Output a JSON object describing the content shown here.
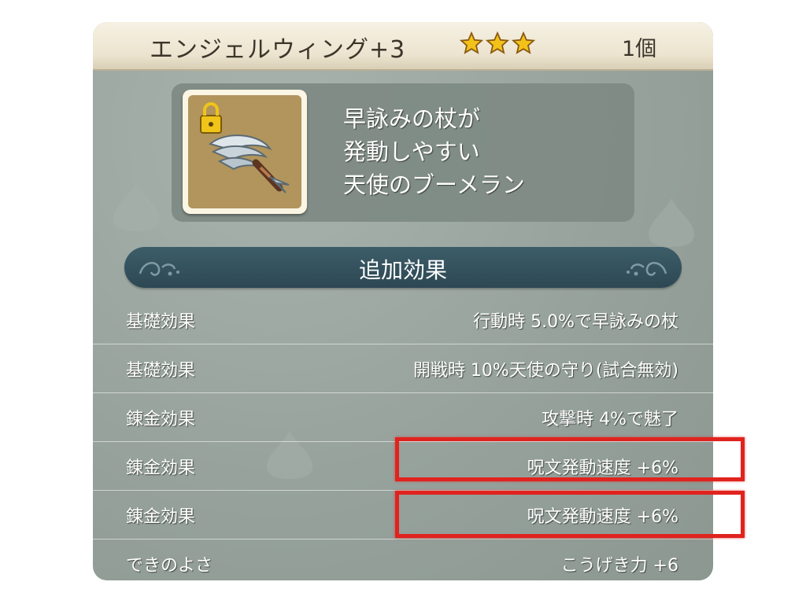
{
  "item": {
    "name": "エンジェルウィング+3",
    "stars": 3,
    "count": "1個",
    "icon": "angel-wing-boomerang-icon"
  },
  "description": {
    "lines": [
      "早詠みの杖が",
      "発動しやすい",
      "天使のブーメラン"
    ]
  },
  "section": {
    "title": "追加効果"
  },
  "effects": [
    {
      "label": "基礎効果",
      "value": "行動時 5.0%で早詠みの杖"
    },
    {
      "label": "基礎効果",
      "value": "開戦時 10%天使の守り(試合無効)"
    },
    {
      "label": "錬金効果",
      "value": "攻撃時 4%で魅了"
    },
    {
      "label": "錬金効果",
      "value": "呪文発動速度 +6%"
    },
    {
      "label": "錬金効果",
      "value": "呪文発動速度 +6%"
    },
    {
      "label": "できのよさ",
      "value": "こうげき力 +6"
    }
  ],
  "colors": {
    "panel": "#97a29c",
    "header_bar": "#2d4853",
    "star": "#f2c21b",
    "highlight": "#e0231f"
  }
}
